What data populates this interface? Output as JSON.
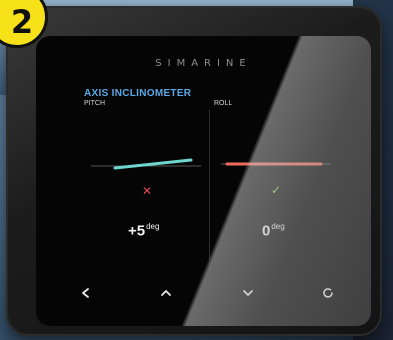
{
  "badge": {
    "text": "2"
  },
  "device": {
    "brand": "SIMARINE",
    "app_title": "AXIS INCLINOMETER",
    "pitch": {
      "label": "PITCH",
      "value": "+5",
      "unit": "deg",
      "status_icon": "x-icon",
      "status_color": "#e04a4a",
      "line_color": "#6fd6cf"
    },
    "roll": {
      "label": "ROLL",
      "value": "0",
      "unit": "deg",
      "status_icon": "check-icon",
      "status_color": "#9bd14a",
      "line_color": "#ef6b5a"
    },
    "nav": [
      {
        "icon": "chevron-left-icon"
      },
      {
        "icon": "chevron-up-icon"
      },
      {
        "icon": "chevron-down-icon"
      },
      {
        "icon": "refresh-icon"
      }
    ]
  }
}
